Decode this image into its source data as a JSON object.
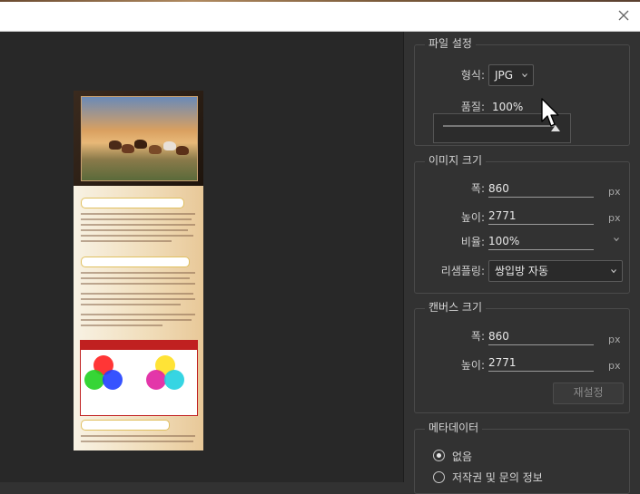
{
  "dialog": {
    "close_icon": "close-icon"
  },
  "file_settings": {
    "title": "파일 설정",
    "format_label": "형식:",
    "format_value": "JPG",
    "quality_label": "품질:",
    "quality_value": "100%",
    "quality_slider_fraction": 1.0
  },
  "image_size": {
    "title": "이미지 크기",
    "width_label": "폭:",
    "width_value": "860",
    "width_unit": "px",
    "height_label": "높이:",
    "height_value": "2771",
    "height_unit": "px",
    "ratio_label": "비율:",
    "ratio_value": "100%",
    "resample_label": "리샘플링:",
    "resample_value": "쌍입방 자동"
  },
  "canvas_size": {
    "title": "캔버스 크기",
    "width_label": "폭:",
    "width_value": "860",
    "width_unit": "px",
    "height_label": "높이:",
    "height_value": "2771",
    "height_unit": "px",
    "reset_label": "재설정"
  },
  "metadata": {
    "title": "메타데이터",
    "options": [
      {
        "label": "없음",
        "selected": true
      },
      {
        "label": "저작권 및 문의 정보",
        "selected": false
      }
    ]
  },
  "colors": {
    "panel_bg": "#323232",
    "preview_bg": "#282828",
    "text": "#d6d6d6"
  }
}
